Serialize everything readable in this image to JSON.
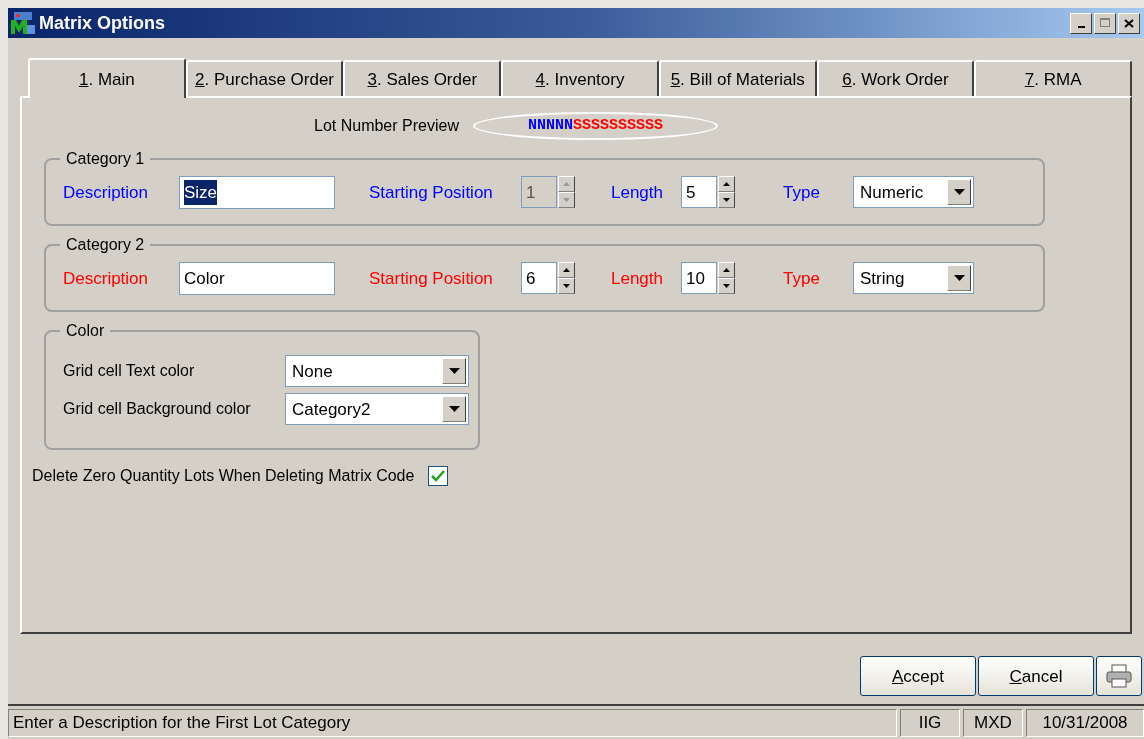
{
  "window": {
    "title": "Matrix Options"
  },
  "tabs": [
    {
      "label": "1. Main",
      "selected": true
    },
    {
      "label": "2. Purchase Order",
      "selected": false
    },
    {
      "label": "3. Sales Order",
      "selected": false
    },
    {
      "label": "4. Inventory",
      "selected": false
    },
    {
      "label": "5. Bill of Materials",
      "selected": false
    },
    {
      "label": "6. Work Order",
      "selected": false
    },
    {
      "label": "7. RMA",
      "selected": false
    }
  ],
  "lot_preview": {
    "label": "Lot Number Preview",
    "segments": [
      {
        "text": "NNNNN",
        "color": "#0000ff"
      },
      {
        "text": "SSSSSSSSSS",
        "color": "#ff0000"
      }
    ]
  },
  "categories": [
    {
      "title": "Category 1",
      "color": "#0000ff",
      "description_label": "Description",
      "description": "Size",
      "description_highlighted": true,
      "start_label": "Starting Position",
      "start": "1",
      "start_disabled": true,
      "length_label": "Length",
      "length": "5",
      "type_label": "Type",
      "type": "Numeric"
    },
    {
      "title": "Category 2",
      "color": "#ff0000",
      "description_label": "Description",
      "description": "Color",
      "description_highlighted": false,
      "start_label": "Starting Position",
      "start": "6",
      "start_disabled": false,
      "length_label": "Length",
      "length": "10",
      "type_label": "Type",
      "type": "String"
    }
  ],
  "color_group": {
    "title": "Color",
    "rows": [
      {
        "label": "Grid cell Text color",
        "value": "None"
      },
      {
        "label": "Grid cell Background color",
        "value": "Category2"
      }
    ]
  },
  "delete_zero": {
    "label": "Delete Zero Quantity Lots When Deleting Matrix Code",
    "checked": true
  },
  "buttons": [
    "Accept",
    "Cancel"
  ],
  "status_bar": {
    "message": "Enter a Description for the First Lot Category",
    "panels": [
      "IIG",
      "MXD",
      "10/31/2008"
    ]
  }
}
